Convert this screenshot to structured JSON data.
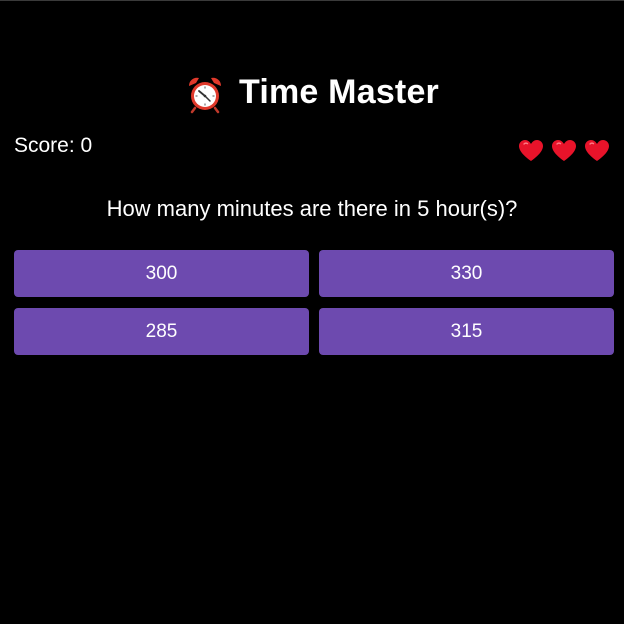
{
  "game": {
    "title": "Time Master",
    "title_icon": "alarm-clock-icon",
    "score_label": "Score: 0",
    "score": 0,
    "lives": 3,
    "life_icon": "heart-icon",
    "question": "How many minutes are there in 5 hour(s)?",
    "answers": [
      {
        "label": "300"
      },
      {
        "label": "330"
      },
      {
        "label": "285"
      },
      {
        "label": "315"
      }
    ]
  },
  "colors": {
    "background": "#000000",
    "button": "#6d4aaf",
    "heart": "#e8132a",
    "clock": "#e0392b"
  }
}
